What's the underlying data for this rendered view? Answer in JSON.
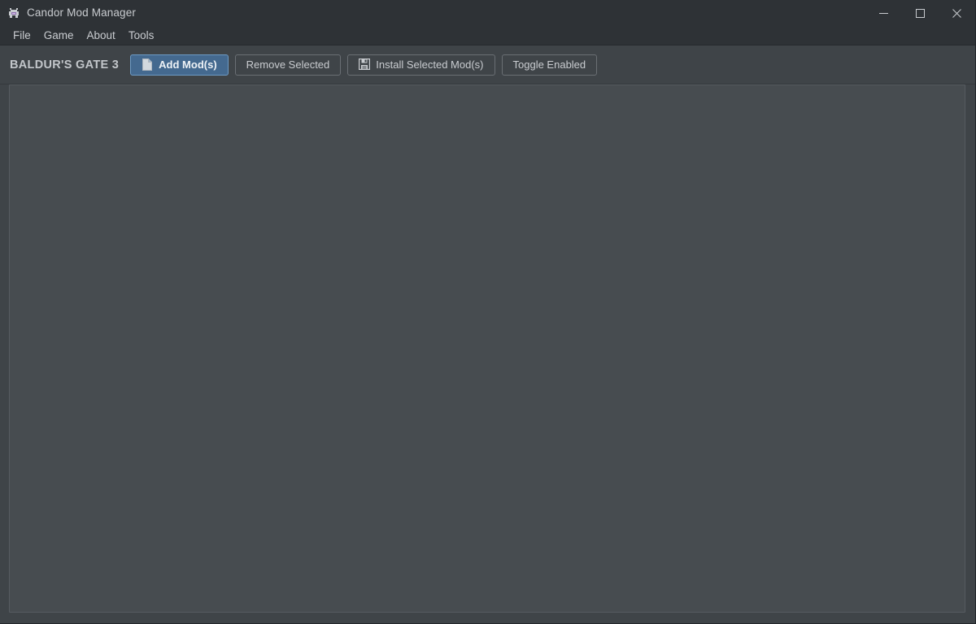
{
  "window": {
    "title": "Candor Mod Manager",
    "icon": "app-logo-icon",
    "controls": {
      "minimize": "minimize-icon",
      "maximize": "maximize-icon",
      "close": "close-icon"
    }
  },
  "menubar": {
    "items": [
      {
        "label": "File"
      },
      {
        "label": "Game"
      },
      {
        "label": "About"
      },
      {
        "label": "Tools"
      }
    ]
  },
  "toolbar": {
    "game_title": "BALDUR'S GATE 3",
    "buttons": [
      {
        "label": "Add Mod(s)",
        "icon": "document-icon",
        "primary": true
      },
      {
        "label": "Remove Selected",
        "icon": null,
        "primary": false
      },
      {
        "label": "Install Selected Mod(s)",
        "icon": "floppy-disk-icon",
        "primary": false
      },
      {
        "label": "Toggle Enabled",
        "icon": null,
        "primary": false
      }
    ]
  },
  "main": {
    "mod_list": {
      "items": [],
      "empty_text": ""
    }
  },
  "colors": {
    "titlebar_bg": "#2e3236",
    "toolbar_bg": "#3f4448",
    "content_bg": "#474c50",
    "content_border": "#565b60",
    "accent": "#44698f",
    "accent_border": "#6d9ac4",
    "text": "#c9ccd0"
  }
}
